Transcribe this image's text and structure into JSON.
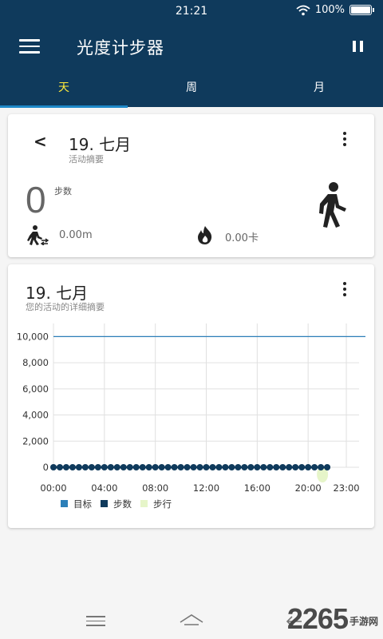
{
  "status_bar": {
    "time": "21:21",
    "battery": "100%"
  },
  "app": {
    "title": "光度计步器"
  },
  "tabs": [
    {
      "label": "天",
      "active": true
    },
    {
      "label": "周",
      "active": false
    },
    {
      "label": "月",
      "active": false
    }
  ],
  "summary_card": {
    "date": "19. 七月",
    "subtitle": "活动摘要",
    "steps_value": "0",
    "steps_label": "步数",
    "distance": "0.00m",
    "calories": "0.00卡"
  },
  "detail_card": {
    "date": "19. 七月",
    "subtitle": "您的活动的详细摘要"
  },
  "chart_data": {
    "type": "line",
    "x": [
      "00:00",
      "00:30",
      "01:00",
      "01:30",
      "02:00",
      "02:30",
      "03:00",
      "03:30",
      "04:00",
      "04:30",
      "05:00",
      "05:30",
      "06:00",
      "06:30",
      "07:00",
      "07:30",
      "08:00",
      "08:30",
      "09:00",
      "09:30",
      "10:00",
      "10:30",
      "11:00",
      "11:30",
      "12:00",
      "12:30",
      "13:00",
      "13:30",
      "14:00",
      "14:30",
      "15:00",
      "15:30",
      "16:00",
      "16:30",
      "17:00",
      "17:30",
      "18:00",
      "18:30",
      "19:00",
      "19:30",
      "20:00",
      "20:30",
      "21:00",
      "21:30"
    ],
    "x_tick_labels": [
      "00:00",
      "04:00",
      "08:00",
      "12:00",
      "16:00",
      "20:00",
      "23:00"
    ],
    "y_tick_labels": [
      "0",
      "2,000",
      "4,000",
      "6,000",
      "8,000",
      "10,000"
    ],
    "ylim": [
      0,
      11000
    ],
    "series": [
      {
        "name": "目标",
        "color": "#2c7fb8",
        "values": [
          10000
        ]
      },
      {
        "name": "步数",
        "color": "#0f3a5c",
        "values": [
          0,
          0,
          0,
          0,
          0,
          0,
          0,
          0,
          0,
          0,
          0,
          0,
          0,
          0,
          0,
          0,
          0,
          0,
          0,
          0,
          0,
          0,
          0,
          0,
          0,
          0,
          0,
          0,
          0,
          0,
          0,
          0,
          0,
          0,
          0,
          0,
          0,
          0,
          0,
          0,
          0,
          0,
          0,
          0
        ]
      },
      {
        "name": "步行",
        "color": "#e6f5c9",
        "values": [
          0
        ]
      }
    ],
    "legend_position": "bottom-left",
    "grid": true
  },
  "nav_bar": {
    "icons": [
      "menu-icon",
      "home-icon",
      "back-icon"
    ]
  },
  "watermark": {
    "text": "2265",
    "site": "手游网"
  }
}
